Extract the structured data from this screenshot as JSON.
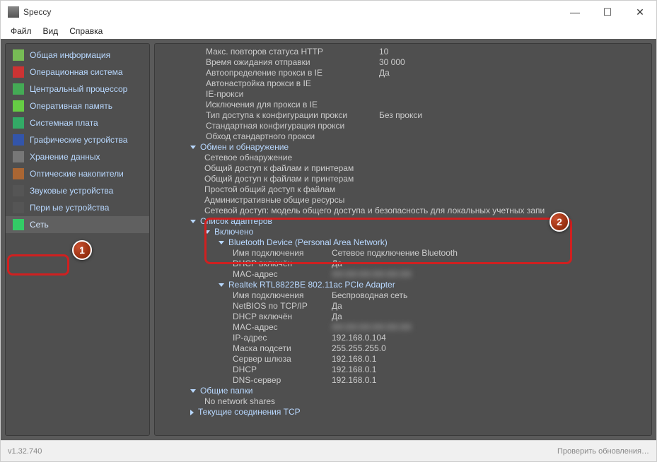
{
  "app": {
    "title": "Speccy",
    "version": "v1.32.740",
    "update_check": "Проверить обновления…"
  },
  "menu": {
    "file": "Файл",
    "view": "Вид",
    "help": "Справка"
  },
  "sidebar": {
    "items": [
      {
        "label": "Общая информация"
      },
      {
        "label": "Операционная система"
      },
      {
        "label": "Центральный процессор"
      },
      {
        "label": "Оперативная память"
      },
      {
        "label": "Системная плата"
      },
      {
        "label": "Графические устройства"
      },
      {
        "label": "Хранение данных"
      },
      {
        "label": "Оптические накопители"
      },
      {
        "label": "Звуковые устройства"
      },
      {
        "label": "Пери               ые устройства"
      },
      {
        "label": "Сеть"
      }
    ]
  },
  "content": {
    "top": [
      {
        "k": "Макс. повторов статуса HTTP",
        "v": "10"
      },
      {
        "k": "Время ожидания отправки",
        "v": "30 000"
      },
      {
        "k": "Автоопределение прокси в IE",
        "v": "Да"
      },
      {
        "k": "Автонастройка прокси в IE",
        "v": ""
      },
      {
        "k": "IE-прокси",
        "v": ""
      },
      {
        "k": "Исключения для прокси в IE",
        "v": ""
      },
      {
        "k": "Тип доступа к конфигурации прокси",
        "v": "Без прокси"
      },
      {
        "k": "Стандартная конфигурация прокси",
        "v": ""
      },
      {
        "k": "Обход стандартного прокси",
        "v": ""
      }
    ],
    "exchange": {
      "title": "Обмен и обнаружение",
      "rows": [
        {
          "k": "Сетевое обнаружение",
          "v": ""
        },
        {
          "k": "Общий доступ к файлам и принтерам",
          "v": ""
        },
        {
          "k": "Общий доступ к файлам и принтерам",
          "v": ""
        },
        {
          "k": "Простой общий доступ к файлам",
          "v": ""
        },
        {
          "k": "Административные общие ресурсы",
          "v": ""
        },
        {
          "k": "Сетевой доступ: модель общего доступа и безопасность для локальных учетных запи",
          "v": ""
        }
      ]
    },
    "adapters": {
      "title": "Список адаптеров",
      "enabled": "Включено",
      "bt": {
        "title": "Bluetooth Device (Personal Area Network)",
        "rows": [
          {
            "k": "Имя подключения",
            "v": "Сетевое подключение Bluetooth"
          },
          {
            "k": "DHCP включён",
            "v": "Да"
          },
          {
            "k": "MAC-адрес",
            "v": "XX:XX:XX:XX:XX:XX"
          }
        ]
      },
      "wifi": {
        "title": "Realtek RTL8822BE 802.11ac PCIe Adapter",
        "rows": [
          {
            "k": "Имя подключения",
            "v": "Беспроводная сеть"
          },
          {
            "k": "NetBIOS по TCP/IP",
            "v": "Да"
          },
          {
            "k": "DHCP включён",
            "v": "Да"
          },
          {
            "k": "MAC-адрес",
            "v": "XX:XX:XX:XX:XX:XX"
          },
          {
            "k": "IP-адрес",
            "v": "192.168.0.104"
          },
          {
            "k": "Маска подсети",
            "v": "255.255.255.0"
          },
          {
            "k": "Сервер шлюза",
            "v": "192.168.0.1"
          },
          {
            "k": "DHCP",
            "v": "192.168.0.1"
          },
          {
            "k": "DNS-сервер",
            "v": "192.168.0.1"
          }
        ]
      }
    },
    "shared": {
      "title": "Общие папки",
      "none": "No network shares"
    },
    "tcp": {
      "title": "Текущие соединения TCP"
    }
  },
  "callouts": {
    "one": "1",
    "two": "2"
  }
}
